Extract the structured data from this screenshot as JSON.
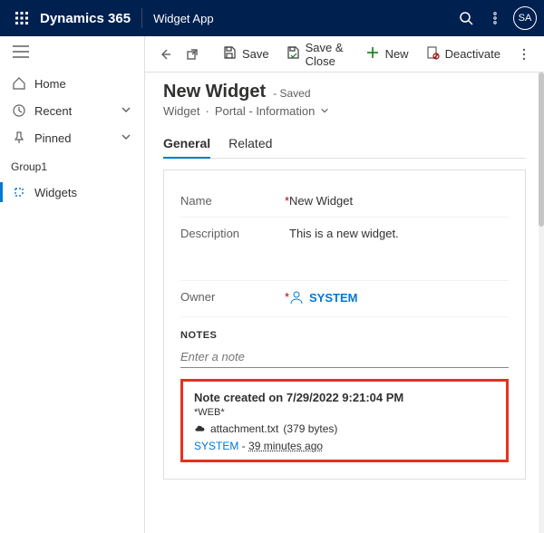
{
  "topbar": {
    "brand": "Dynamics 365",
    "app": "Widget App",
    "avatar": "SA"
  },
  "sidebar": {
    "items": [
      {
        "label": "Home"
      },
      {
        "label": "Recent"
      },
      {
        "label": "Pinned"
      }
    ],
    "group_label": "Group1",
    "group_items": [
      {
        "label": "Widgets"
      }
    ]
  },
  "commands": {
    "save": "Save",
    "save_close": "Save & Close",
    "new": "New",
    "deactivate": "Deactivate"
  },
  "record": {
    "title": "New Widget",
    "status": "- Saved",
    "entity": "Widget",
    "form": "Portal - Information"
  },
  "tabs": {
    "general": "General",
    "related": "Related"
  },
  "fields": {
    "name_label": "Name",
    "name_value": "New Widget",
    "desc_label": "Description",
    "desc_value": "This is a new widget.",
    "owner_label": "Owner",
    "owner_value": "SYSTEM"
  },
  "notes": {
    "section_label": "NOTES",
    "placeholder": "Enter a note",
    "note_title": "Note created on 7/29/2022 9:21:04 PM",
    "note_source": "*WEB*",
    "attachment_name": "attachment.txt",
    "attachment_size": "(379 bytes)",
    "meta_user": "SYSTEM",
    "meta_sep": " - ",
    "meta_ago": "39 minutes ago"
  }
}
